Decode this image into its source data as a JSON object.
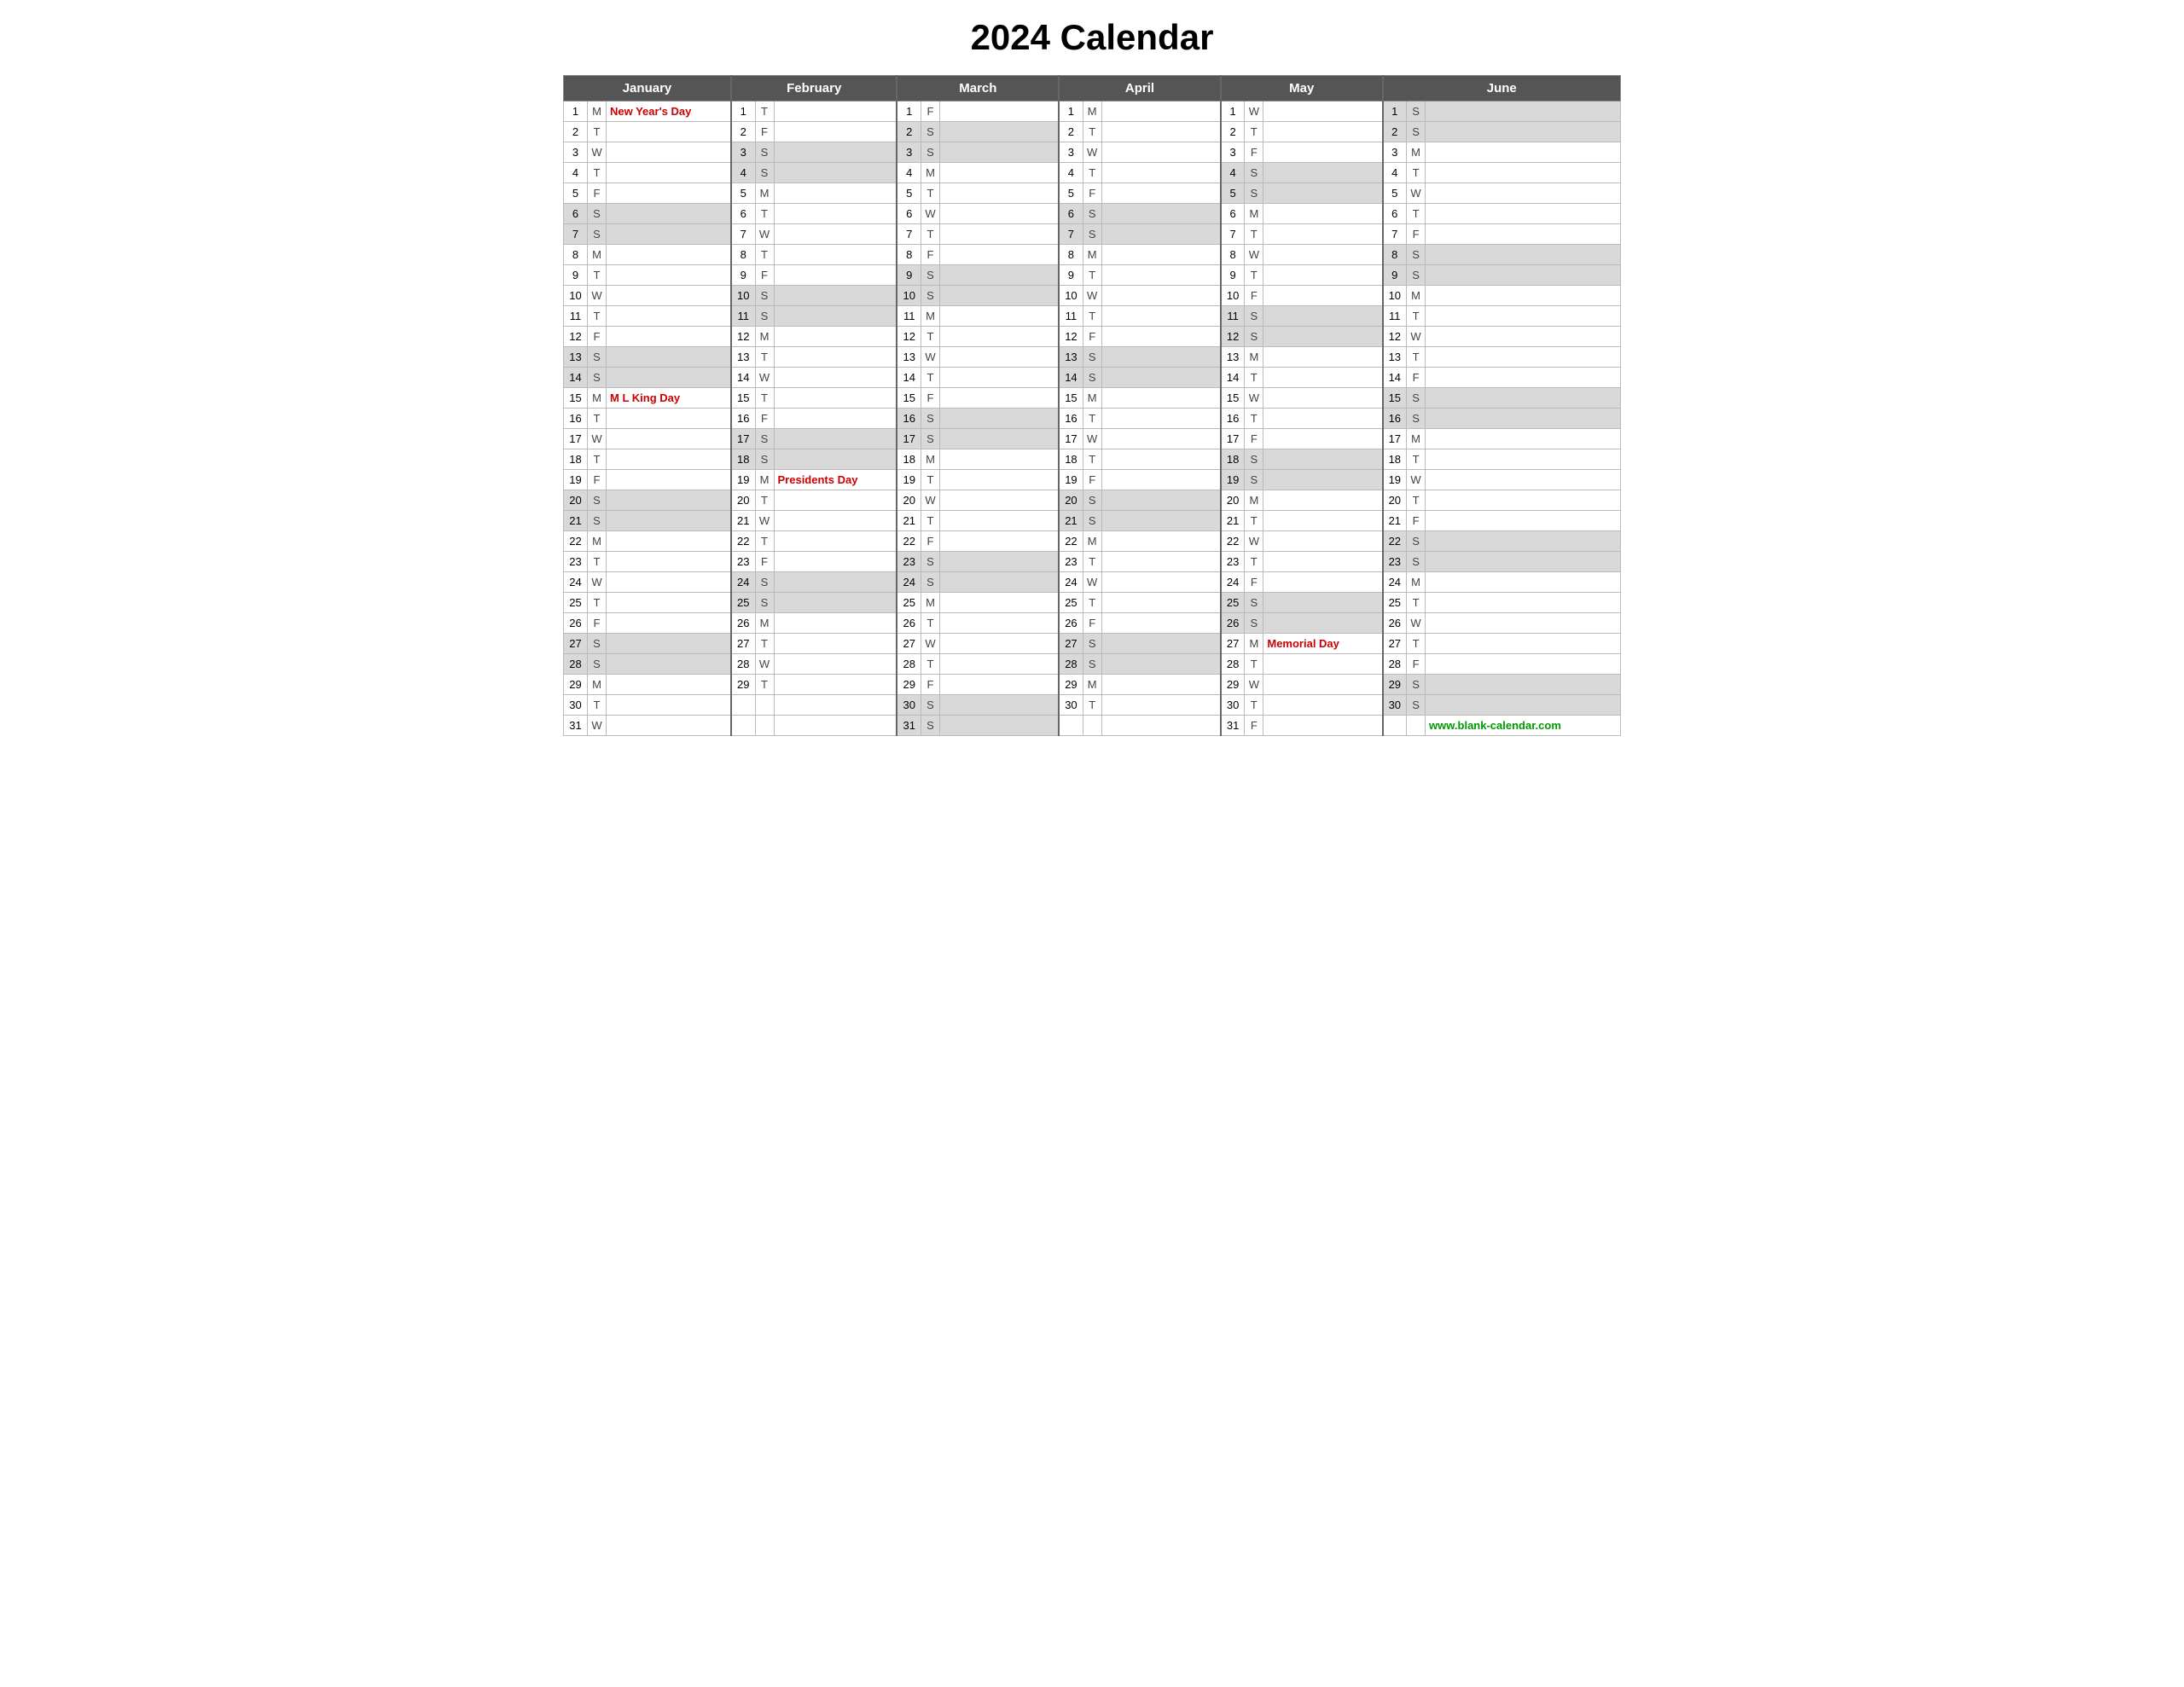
{
  "title": "2024 Calendar",
  "months": [
    "January",
    "February",
    "March",
    "April",
    "May",
    "June"
  ],
  "website": "www.blank-calendar.com",
  "days": {
    "jan": [
      {
        "d": 1,
        "wd": "M",
        "holiday": "New Year's Day"
      },
      {
        "d": 2,
        "wd": "T"
      },
      {
        "d": 3,
        "wd": "W"
      },
      {
        "d": 4,
        "wd": "T"
      },
      {
        "d": 5,
        "wd": "F"
      },
      {
        "d": 6,
        "wd": "S",
        "weekend": true
      },
      {
        "d": 7,
        "wd": "S",
        "weekend": true
      },
      {
        "d": 8,
        "wd": "M"
      },
      {
        "d": 9,
        "wd": "T"
      },
      {
        "d": 10,
        "wd": "W"
      },
      {
        "d": 11,
        "wd": "T"
      },
      {
        "d": 12,
        "wd": "F"
      },
      {
        "d": 13,
        "wd": "S",
        "weekend": true
      },
      {
        "d": 14,
        "wd": "S",
        "weekend": true
      },
      {
        "d": 15,
        "wd": "M",
        "holiday": "M L King Day"
      },
      {
        "d": 16,
        "wd": "T"
      },
      {
        "d": 17,
        "wd": "W"
      },
      {
        "d": 18,
        "wd": "T"
      },
      {
        "d": 19,
        "wd": "F"
      },
      {
        "d": 20,
        "wd": "S",
        "weekend": true
      },
      {
        "d": 21,
        "wd": "S",
        "weekend": true
      },
      {
        "d": 22,
        "wd": "M"
      },
      {
        "d": 23,
        "wd": "T"
      },
      {
        "d": 24,
        "wd": "W"
      },
      {
        "d": 25,
        "wd": "T"
      },
      {
        "d": 26,
        "wd": "F"
      },
      {
        "d": 27,
        "wd": "S",
        "weekend": true
      },
      {
        "d": 28,
        "wd": "S",
        "weekend": true
      },
      {
        "d": 29,
        "wd": "M"
      },
      {
        "d": 30,
        "wd": "T"
      },
      {
        "d": 31,
        "wd": "W"
      }
    ],
    "feb": [
      {
        "d": 1,
        "wd": "T"
      },
      {
        "d": 2,
        "wd": "F"
      },
      {
        "d": 3,
        "wd": "S",
        "weekend": true
      },
      {
        "d": 4,
        "wd": "S",
        "weekend": true
      },
      {
        "d": 5,
        "wd": "M"
      },
      {
        "d": 6,
        "wd": "T"
      },
      {
        "d": 7,
        "wd": "W"
      },
      {
        "d": 8,
        "wd": "T"
      },
      {
        "d": 9,
        "wd": "F"
      },
      {
        "d": 10,
        "wd": "S",
        "weekend": true
      },
      {
        "d": 11,
        "wd": "S",
        "weekend": true
      },
      {
        "d": 12,
        "wd": "M"
      },
      {
        "d": 13,
        "wd": "T"
      },
      {
        "d": 14,
        "wd": "W"
      },
      {
        "d": 15,
        "wd": "T"
      },
      {
        "d": 16,
        "wd": "F"
      },
      {
        "d": 17,
        "wd": "S",
        "weekend": true
      },
      {
        "d": 18,
        "wd": "S",
        "weekend": true
      },
      {
        "d": 19,
        "wd": "M",
        "holiday": "Presidents Day"
      },
      {
        "d": 20,
        "wd": "T"
      },
      {
        "d": 21,
        "wd": "W"
      },
      {
        "d": 22,
        "wd": "T"
      },
      {
        "d": 23,
        "wd": "F"
      },
      {
        "d": 24,
        "wd": "S",
        "weekend": true
      },
      {
        "d": 25,
        "wd": "S",
        "weekend": true
      },
      {
        "d": 26,
        "wd": "M"
      },
      {
        "d": 27,
        "wd": "T"
      },
      {
        "d": 28,
        "wd": "W"
      },
      {
        "d": 29,
        "wd": "T"
      }
    ],
    "mar": [
      {
        "d": 1,
        "wd": "F"
      },
      {
        "d": 2,
        "wd": "S",
        "weekend": true
      },
      {
        "d": 3,
        "wd": "S",
        "weekend": true
      },
      {
        "d": 4,
        "wd": "M"
      },
      {
        "d": 5,
        "wd": "T"
      },
      {
        "d": 6,
        "wd": "W"
      },
      {
        "d": 7,
        "wd": "T"
      },
      {
        "d": 8,
        "wd": "F"
      },
      {
        "d": 9,
        "wd": "S",
        "weekend": true
      },
      {
        "d": 10,
        "wd": "S",
        "weekend": true
      },
      {
        "d": 11,
        "wd": "M"
      },
      {
        "d": 12,
        "wd": "T"
      },
      {
        "d": 13,
        "wd": "W"
      },
      {
        "d": 14,
        "wd": "T"
      },
      {
        "d": 15,
        "wd": "F"
      },
      {
        "d": 16,
        "wd": "S",
        "weekend": true
      },
      {
        "d": 17,
        "wd": "S",
        "weekend": true
      },
      {
        "d": 18,
        "wd": "M"
      },
      {
        "d": 19,
        "wd": "T"
      },
      {
        "d": 20,
        "wd": "W"
      },
      {
        "d": 21,
        "wd": "T"
      },
      {
        "d": 22,
        "wd": "F"
      },
      {
        "d": 23,
        "wd": "S",
        "weekend": true
      },
      {
        "d": 24,
        "wd": "S",
        "weekend": true
      },
      {
        "d": 25,
        "wd": "M"
      },
      {
        "d": 26,
        "wd": "T"
      },
      {
        "d": 27,
        "wd": "W"
      },
      {
        "d": 28,
        "wd": "T"
      },
      {
        "d": 29,
        "wd": "F"
      },
      {
        "d": 30,
        "wd": "S",
        "weekend": true
      },
      {
        "d": 31,
        "wd": "S",
        "weekend": true
      }
    ],
    "apr": [
      {
        "d": 1,
        "wd": "M"
      },
      {
        "d": 2,
        "wd": "T"
      },
      {
        "d": 3,
        "wd": "W"
      },
      {
        "d": 4,
        "wd": "T"
      },
      {
        "d": 5,
        "wd": "F"
      },
      {
        "d": 6,
        "wd": "S",
        "weekend": true
      },
      {
        "d": 7,
        "wd": "S",
        "weekend": true
      },
      {
        "d": 8,
        "wd": "M"
      },
      {
        "d": 9,
        "wd": "T"
      },
      {
        "d": 10,
        "wd": "W"
      },
      {
        "d": 11,
        "wd": "T"
      },
      {
        "d": 12,
        "wd": "F"
      },
      {
        "d": 13,
        "wd": "S",
        "weekend": true
      },
      {
        "d": 14,
        "wd": "S",
        "weekend": true
      },
      {
        "d": 15,
        "wd": "M"
      },
      {
        "d": 16,
        "wd": "T"
      },
      {
        "d": 17,
        "wd": "W"
      },
      {
        "d": 18,
        "wd": "T"
      },
      {
        "d": 19,
        "wd": "F"
      },
      {
        "d": 20,
        "wd": "S",
        "weekend": true
      },
      {
        "d": 21,
        "wd": "S",
        "weekend": true
      },
      {
        "d": 22,
        "wd": "M"
      },
      {
        "d": 23,
        "wd": "T"
      },
      {
        "d": 24,
        "wd": "W"
      },
      {
        "d": 25,
        "wd": "T"
      },
      {
        "d": 26,
        "wd": "F"
      },
      {
        "d": 27,
        "wd": "S",
        "weekend": true
      },
      {
        "d": 28,
        "wd": "S",
        "weekend": true
      },
      {
        "d": 29,
        "wd": "M"
      },
      {
        "d": 30,
        "wd": "T"
      }
    ],
    "may": [
      {
        "d": 1,
        "wd": "W"
      },
      {
        "d": 2,
        "wd": "T"
      },
      {
        "d": 3,
        "wd": "F"
      },
      {
        "d": 4,
        "wd": "S",
        "weekend": true
      },
      {
        "d": 5,
        "wd": "S",
        "weekend": true
      },
      {
        "d": 6,
        "wd": "M"
      },
      {
        "d": 7,
        "wd": "T"
      },
      {
        "d": 8,
        "wd": "W"
      },
      {
        "d": 9,
        "wd": "T"
      },
      {
        "d": 10,
        "wd": "F"
      },
      {
        "d": 11,
        "wd": "S",
        "weekend": true
      },
      {
        "d": 12,
        "wd": "S",
        "weekend": true
      },
      {
        "d": 13,
        "wd": "M"
      },
      {
        "d": 14,
        "wd": "T"
      },
      {
        "d": 15,
        "wd": "W"
      },
      {
        "d": 16,
        "wd": "T"
      },
      {
        "d": 17,
        "wd": "F"
      },
      {
        "d": 18,
        "wd": "S",
        "weekend": true
      },
      {
        "d": 19,
        "wd": "S",
        "weekend": true
      },
      {
        "d": 20,
        "wd": "M"
      },
      {
        "d": 21,
        "wd": "T"
      },
      {
        "d": 22,
        "wd": "W"
      },
      {
        "d": 23,
        "wd": "T"
      },
      {
        "d": 24,
        "wd": "F"
      },
      {
        "d": 25,
        "wd": "S",
        "weekend": true
      },
      {
        "d": 26,
        "wd": "S",
        "weekend": true
      },
      {
        "d": 27,
        "wd": "M",
        "holiday": "Memorial Day"
      },
      {
        "d": 28,
        "wd": "T"
      },
      {
        "d": 29,
        "wd": "W"
      },
      {
        "d": 30,
        "wd": "T"
      },
      {
        "d": 31,
        "wd": "F"
      }
    ],
    "jun": [
      {
        "d": 1,
        "wd": "S",
        "weekend": true
      },
      {
        "d": 2,
        "wd": "S",
        "weekend": true
      },
      {
        "d": 3,
        "wd": "M"
      },
      {
        "d": 4,
        "wd": "T"
      },
      {
        "d": 5,
        "wd": "W"
      },
      {
        "d": 6,
        "wd": "T"
      },
      {
        "d": 7,
        "wd": "F"
      },
      {
        "d": 8,
        "wd": "S",
        "weekend": true
      },
      {
        "d": 9,
        "wd": "S",
        "weekend": true
      },
      {
        "d": 10,
        "wd": "M"
      },
      {
        "d": 11,
        "wd": "T"
      },
      {
        "d": 12,
        "wd": "W"
      },
      {
        "d": 13,
        "wd": "T"
      },
      {
        "d": 14,
        "wd": "F"
      },
      {
        "d": 15,
        "wd": "S",
        "weekend": true
      },
      {
        "d": 16,
        "wd": "S",
        "weekend": true
      },
      {
        "d": 17,
        "wd": "M"
      },
      {
        "d": 18,
        "wd": "T"
      },
      {
        "d": 19,
        "wd": "W"
      },
      {
        "d": 20,
        "wd": "T"
      },
      {
        "d": 21,
        "wd": "F"
      },
      {
        "d": 22,
        "wd": "S",
        "weekend": true
      },
      {
        "d": 23,
        "wd": "S",
        "weekend": true
      },
      {
        "d": 24,
        "wd": "M"
      },
      {
        "d": 25,
        "wd": "T"
      },
      {
        "d": 26,
        "wd": "W"
      },
      {
        "d": 27,
        "wd": "T"
      },
      {
        "d": 28,
        "wd": "F"
      },
      {
        "d": 29,
        "wd": "S",
        "weekend": true
      },
      {
        "d": 30,
        "wd": "S",
        "weekend": true
      }
    ]
  }
}
